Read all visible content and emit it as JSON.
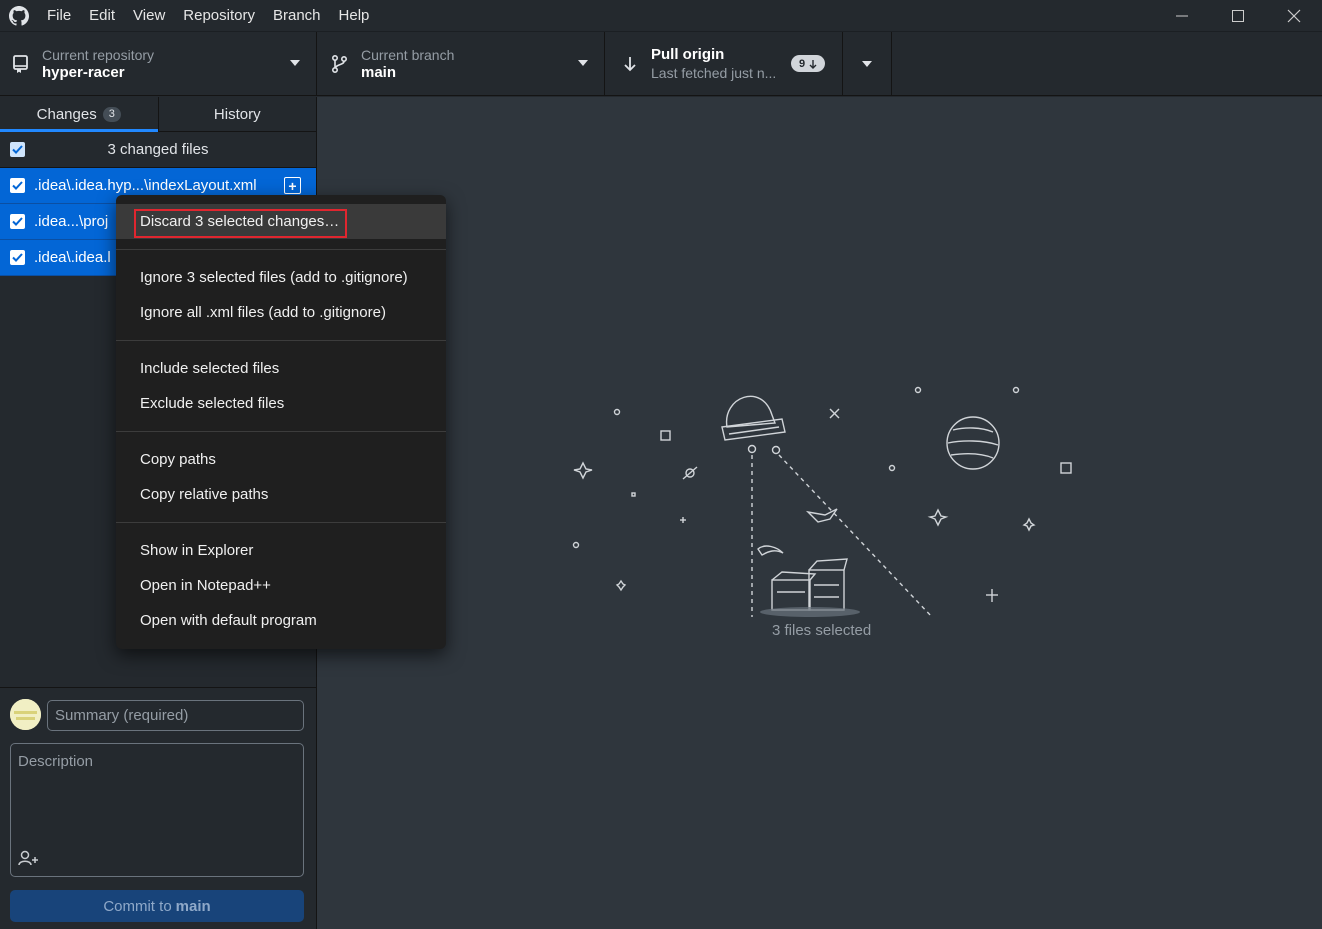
{
  "menubar": {
    "items": [
      "File",
      "Edit",
      "View",
      "Repository",
      "Branch",
      "Help"
    ]
  },
  "toolbar": {
    "repo_label": "Current repository",
    "repo_value": "hyper-racer",
    "branch_label": "Current branch",
    "branch_value": "main",
    "pull_label": "Pull origin",
    "pull_sub": "Last fetched just n...",
    "pull_count": "9"
  },
  "tabs": {
    "changes_label": "Changes",
    "changes_count": "3",
    "history_label": "History"
  },
  "changes": {
    "header": "3 changed files",
    "files": [
      ".idea\\.idea.hyp...\\indexLayout.xml",
      ".idea...\\proj",
      ".idea\\.idea.l"
    ]
  },
  "commit": {
    "summary_placeholder": "Summary (required)",
    "description_placeholder": "Description",
    "button_prefix": "Commit to",
    "button_branch": "main"
  },
  "context_menu": {
    "discard": "Discard 3 selected changes…",
    "ignore_selected": "Ignore 3 selected files (add to .gitignore)",
    "ignore_all": "Ignore all .xml files (add to .gitignore)",
    "include": "Include selected files",
    "exclude": "Exclude selected files",
    "copy_paths": "Copy paths",
    "copy_relative": "Copy relative paths",
    "show_explorer": "Show in Explorer",
    "open_notepad": "Open in Notepad++",
    "open_default": "Open with default program"
  },
  "main": {
    "caption": "3 files selected"
  },
  "colors": {
    "accent": "#0366d6",
    "highlight_border": "#e0262f"
  }
}
